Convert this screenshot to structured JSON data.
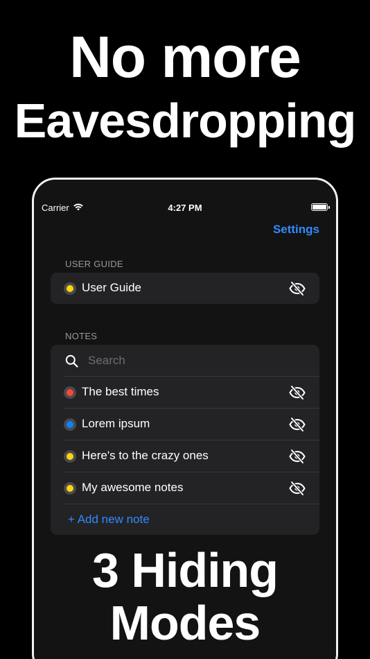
{
  "headline": {
    "line1": "No more",
    "line2": "Eavesdropping",
    "line3": "3 Hiding",
    "line4": "Modes"
  },
  "status_bar": {
    "carrier": "Carrier",
    "time": "4:27 PM"
  },
  "nav": {
    "settings_label": "Settings"
  },
  "user_guide_section": {
    "header": "USER GUIDE",
    "item": {
      "title": "User Guide",
      "color": "#ffd60a"
    }
  },
  "notes_section": {
    "header": "NOTES",
    "search_placeholder": "Search",
    "items": [
      {
        "title": "The best times",
        "color": "#ff453a"
      },
      {
        "title": "Lorem ipsum",
        "color": "#0a84ff"
      },
      {
        "title": "Here's to the crazy ones",
        "color": "#ffd60a"
      },
      {
        "title": "My awesome notes",
        "color": "#ffd60a"
      }
    ],
    "add_label": "+ Add new note"
  },
  "colors": {
    "accent": "#2f8cff",
    "card_background": "#232325",
    "screen_background": "#131313"
  }
}
